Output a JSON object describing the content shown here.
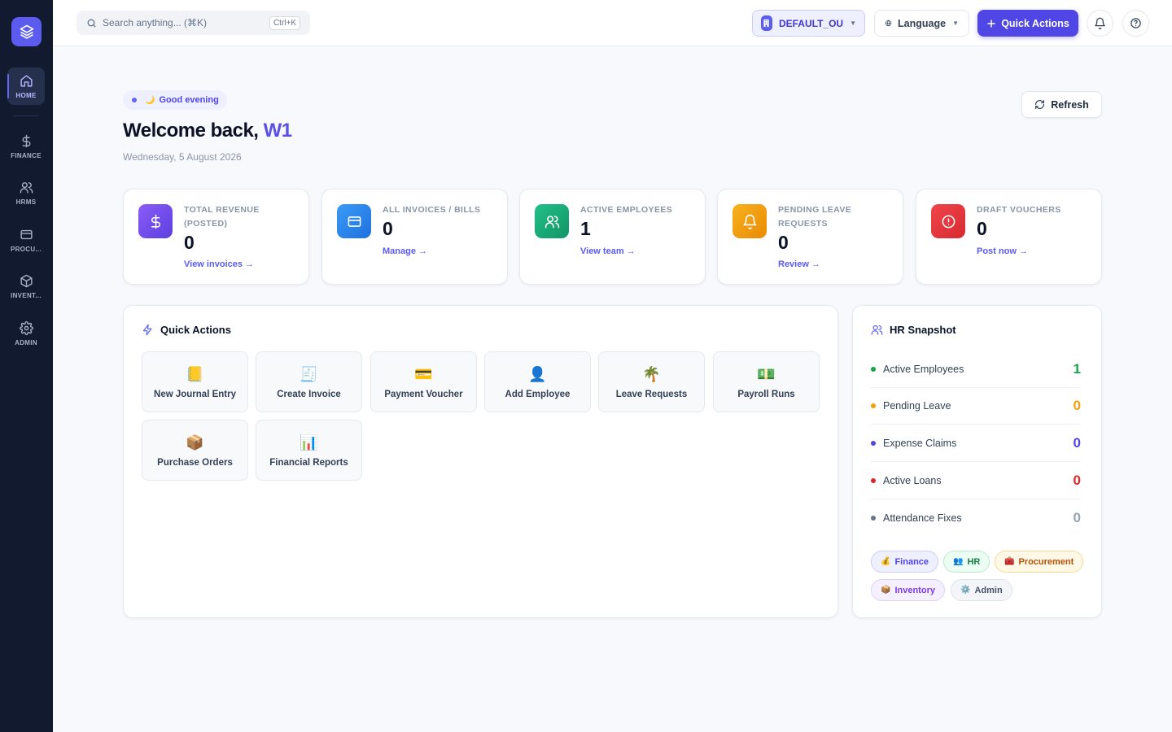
{
  "sidebar": {
    "items": [
      {
        "label": "HOME",
        "icon": "home-icon"
      },
      {
        "label": "FINANCE",
        "icon": "dollar-icon"
      },
      {
        "label": "HRMS",
        "icon": "users-icon"
      },
      {
        "label": "PROCU...",
        "icon": "card-icon"
      },
      {
        "label": "INVENT...",
        "icon": "box-icon"
      },
      {
        "label": "ADMIN",
        "icon": "gear-icon"
      }
    ]
  },
  "topbar": {
    "search_placeholder": "Search anything... (⌘K)",
    "search_shortcut": "Ctrl+K",
    "ou_label": "DEFAULT_OU",
    "language_label": "Language",
    "quick_actions_label": "Quick Actions"
  },
  "greeting": {
    "pill": "Good evening",
    "pill_emoji": "🌙",
    "welcome_prefix": "Welcome back,",
    "user_name": "W1",
    "date": "Wednesday, 5 August 2026",
    "refresh_label": "Refresh"
  },
  "stats": [
    {
      "title": "TOTAL REVENUE (POSTED)",
      "value": "0",
      "link": "View invoices →",
      "color": "#6d4be8"
    },
    {
      "title": "ALL INVOICES / BILLS",
      "value": "0",
      "link": "Manage →",
      "color": "#2f7fe6"
    },
    {
      "title": "ACTIVE EMPLOYEES",
      "value": "1",
      "link": "View team →",
      "color": "#17a574"
    },
    {
      "title": "PENDING LEAVE REQUESTS",
      "value": "0",
      "link": "Review →",
      "color": "#ef9a09"
    },
    {
      "title": "DRAFT VOUCHERS",
      "value": "0",
      "link": "Post now →",
      "color": "#e5383b"
    }
  ],
  "quick_actions": {
    "title": "Quick Actions",
    "items": [
      {
        "label": "New Journal Entry",
        "emoji": "📒"
      },
      {
        "label": "Create Invoice",
        "emoji": "🧾"
      },
      {
        "label": "Payment Voucher",
        "emoji": "💳"
      },
      {
        "label": "Add Employee",
        "emoji": "👤"
      },
      {
        "label": "Leave Requests",
        "emoji": "🌴"
      },
      {
        "label": "Payroll Runs",
        "emoji": "💵"
      },
      {
        "label": "Purchase Orders",
        "emoji": "📦"
      },
      {
        "label": "Financial Reports",
        "emoji": "📊"
      }
    ]
  },
  "hr_snapshot": {
    "title": "HR Snapshot",
    "rows": [
      {
        "label": "Active Employees",
        "value": "1",
        "color": "#16a34a"
      },
      {
        "label": "Pending Leave",
        "value": "0",
        "color": "#f59e0b"
      },
      {
        "label": "Expense Claims",
        "value": "0",
        "color": "#4f46e5"
      },
      {
        "label": "Active Loans",
        "value": "0",
        "color": "#dc2626"
      },
      {
        "label": "Attendance Fixes",
        "value": "0",
        "color": "#94a3b8"
      }
    ],
    "chips": [
      {
        "label": "Finance",
        "emoji": "💰"
      },
      {
        "label": "HR",
        "emoji": "👥"
      },
      {
        "label": "Procurement",
        "emoji": "🧰"
      },
      {
        "label": "Inventory",
        "emoji": "📦"
      },
      {
        "label": "Admin",
        "emoji": "⚙️"
      }
    ]
  }
}
